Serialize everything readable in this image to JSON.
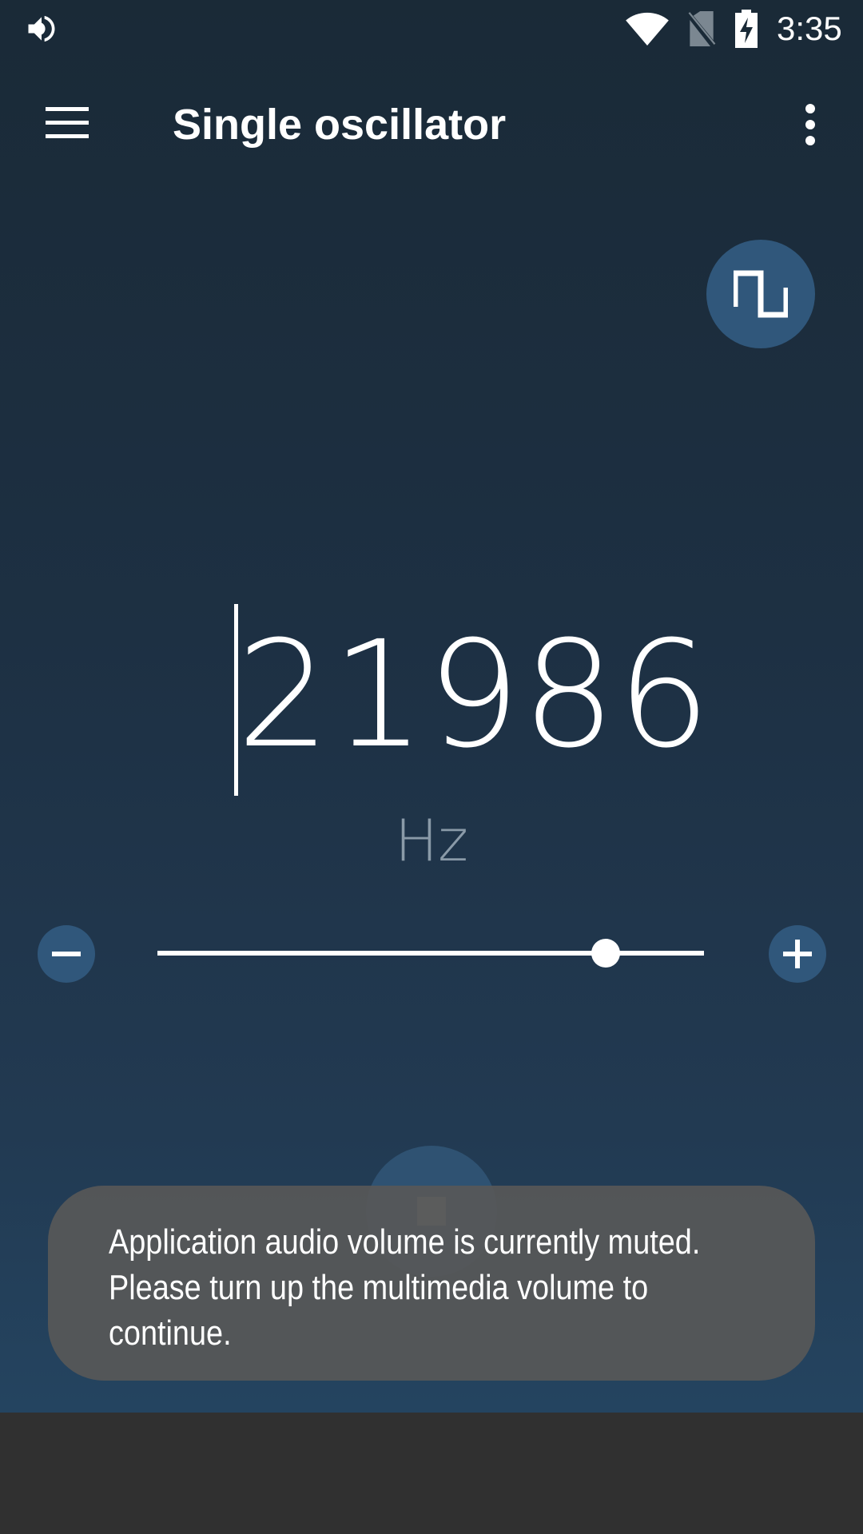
{
  "status_bar": {
    "time": "3:35",
    "icons": [
      "volume-icon",
      "wifi-icon",
      "no-sim-icon",
      "battery-charging-icon"
    ]
  },
  "app_bar": {
    "title": "Single oscillator",
    "menu_icon": "hamburger-menu-icon",
    "overflow_icon": "more-vert-icon"
  },
  "waveform_button": {
    "icon": "square-wave-icon"
  },
  "frequency": {
    "value": "21986",
    "unit": "Hz"
  },
  "slider": {
    "level_fraction": 0.82,
    "decrease_icon": "minus-icon",
    "increase_icon": "plus-icon"
  },
  "play_button": {
    "icon": "stop-icon"
  },
  "toast": {
    "message": "Application audio volume is currently muted. Please turn up the multimedia volume to continue."
  },
  "colors": {
    "accent_button": "#30577b",
    "background_top": "#1a2a37",
    "background_bottom": "#244460",
    "toast_bg": "#585858",
    "nav_bar": "#303030"
  }
}
